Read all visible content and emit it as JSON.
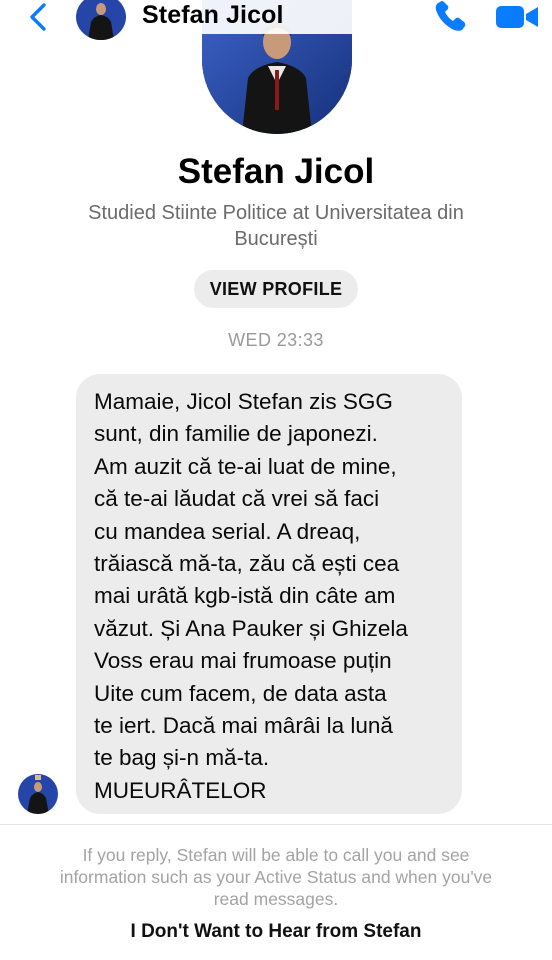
{
  "header": {
    "contact_name": "Stefan Jicol"
  },
  "profile": {
    "name": "Stefan Jicol",
    "subtitle": "Studied Stiinte Politice at Universitatea din București",
    "view_profile_label": "VIEW PROFILE"
  },
  "conversation": {
    "timestamp": "WED 23:33",
    "message_lines": [
      "Mamaie, Jicol Stefan zis SGG",
      "sunt, din familie de japonezi.",
      "Am auzit că te-ai luat de mine,",
      "că te-ai lăudat că vrei să faci",
      "cu mandea serial. A dreaq,",
      "trăiască mă-ta, zău că ești cea",
      "mai urâtă kgb-istă din câte am",
      "văzut. Și Ana Pauker și Ghizela",
      "Voss erau mai frumoase puțin",
      "Uite cum facem, de data asta",
      "te iert. Dacă mai mârâi la lună",
      "te bag și-n mă-ta.",
      "MUEURÂTELOR"
    ]
  },
  "footer": {
    "notice": "If you reply, Stefan will be able to call you and see information such as your Active Status and when you've read messages.",
    "block_label": "I Don't Want to Hear from Stefan"
  },
  "icons": {
    "back": "chevron-left-icon",
    "call": "phone-icon",
    "video": "video-camera-icon"
  },
  "colors": {
    "accent": "#0a7cff",
    "bubble": "#ececec",
    "muted_text": "#6b6b6b"
  }
}
